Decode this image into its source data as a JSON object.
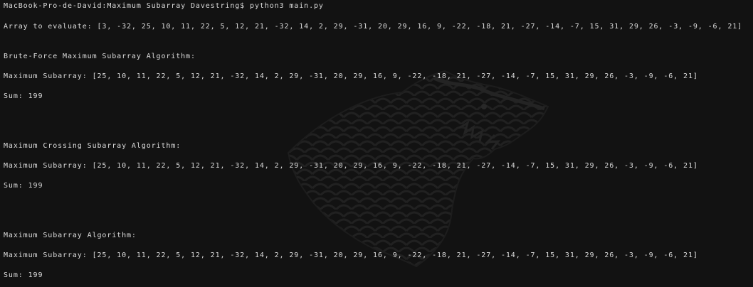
{
  "prompt_line": "MacBook-Pro-de-David:Maximum Subarray Davestring$ python3 main.py",
  "array_line": "Array to evaluate: [3, -32, 25, 10, 11, 22, 5, 12, 21, -32, 14, 2, 29, -31, 20, 29, 16, 9, -22, -18, 21, -27, -14, -7, 15, 31, 29, 26, -3, -9, -6, 21]",
  "sections": [
    {
      "heading": "Brute-Force Maximum Subarray Algorithm:",
      "result": "Maximum Subarray: [25, 10, 11, 22, 5, 12, 21, -32, 14, 2, 29, -31, 20, 29, 16, 9, -22, -18, 21, -27, -14, -7, 15, 31, 29, 26, -3, -9, -6, 21]",
      "sum": "Sum: 199"
    },
    {
      "heading": "Maximum Crossing Subarray Algorithm:",
      "result": "Maximum Subarray: [25, 10, 11, 22, 5, 12, 21, -32, 14, 2, 29, -31, 20, 29, 16, 9, -22, -18, 21, -27, -14, -7, 15, 31, 29, 26, -3, -9, -6, 21]",
      "sum": "Sum: 199"
    },
    {
      "heading": "Maximum Subarray Algorithm:",
      "result": "Maximum Subarray: [25, 10, 11, 22, 5, 12, 21, -32, 14, 2, 29, -31, 20, 29, 16, 9, -22, -18, 21, -27, -14, -7, 15, 31, 29, 26, -3, -9, -6, 21]",
      "sum": "Sum: 199"
    }
  ],
  "background_icon": "direwolf-sigil-icon",
  "colors": {
    "background": "#121212",
    "text": "#dcdcdc",
    "watermark": "#2a2a2a"
  }
}
